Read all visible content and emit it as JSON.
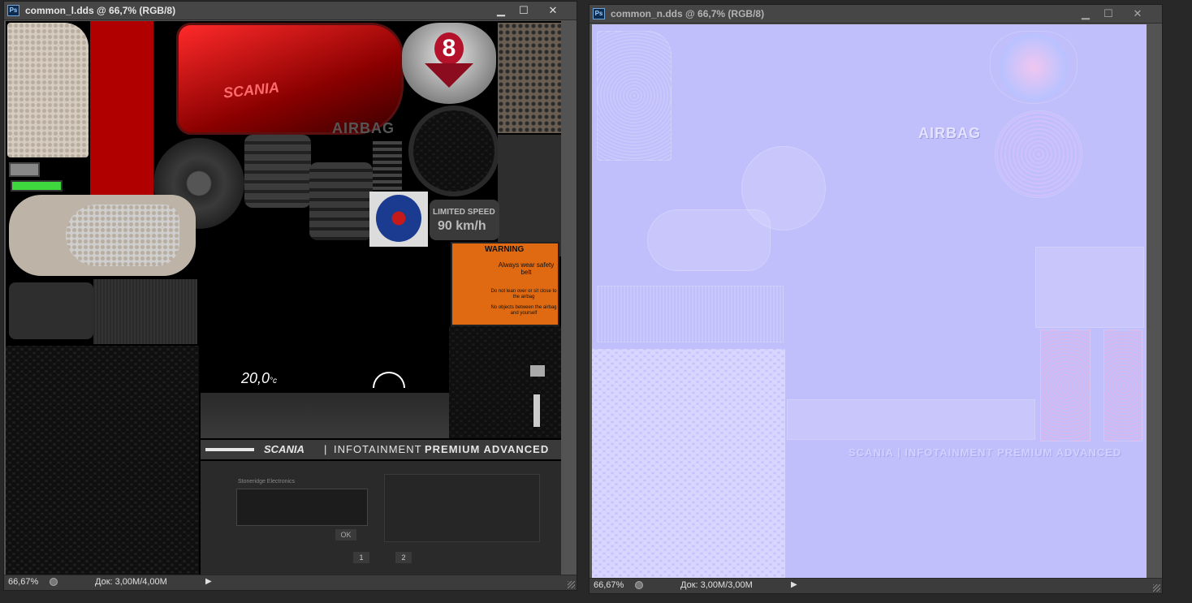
{
  "windows": [
    {
      "title": "common_l.dds @ 66,7% (RGB/8)",
      "zoom": "66,67%",
      "doc_info": "Док: 3,00M/4,00M",
      "active": true
    },
    {
      "title": "common_n.dds @ 66,7% (RGB/8)",
      "zoom": "66,67%",
      "doc_info": "Док: 3,00M/3,00M",
      "active": false
    }
  ],
  "window_buttons": {
    "minimize": "▁",
    "maximize": "☐",
    "close": "✕"
  },
  "app_icon_label": "Ps",
  "texture": {
    "airbag": "AIRBAG",
    "limited_speed": "LIMITED SPEED",
    "speed_value": "90 km/h",
    "temperature": "20,0",
    "temperature_unit": "°c",
    "scania_logo": "SCANIA",
    "infotainment": "INFOTAINMENT",
    "premium_advanced": "PREMIUM ADVANCED",
    "warning_title": "WARNING",
    "warning_line1": "Always wear safety belt",
    "warning_line2": "Do not lean over or sit close to the airbag",
    "warning_line3": "No objects between the airbag and yourself",
    "tacho_brand": "Stoneridge Electronics",
    "tacho_ok": "OK",
    "tacho_slot1": "1",
    "tacho_slot2": "2",
    "v8_badge": "8"
  },
  "normal_map": {
    "airbag": "AIRBAG",
    "scania_line": "SCANIA | INFOTAINMENT PREMIUM ADVANCED"
  },
  "colors": {
    "workspace": "#282828",
    "normal_map_base": "#c1bffb",
    "warning_orange": "#e06a12",
    "scania_blue": "#1a3b8f"
  }
}
